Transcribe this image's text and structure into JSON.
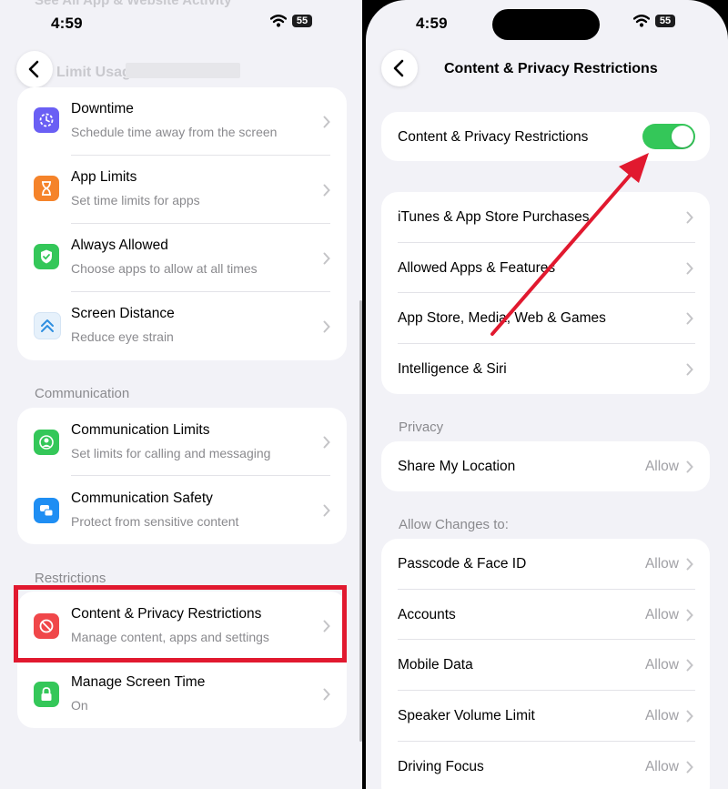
{
  "left": {
    "status": {
      "time": "4:59",
      "battery": "55"
    },
    "faded_top": "See All App & Website Activity",
    "faded_header": "Limit Usage",
    "rows_usage": [
      {
        "title": "Downtime",
        "subtitle": "Schedule time away from the screen",
        "icon": "downtime-icon",
        "color": "#6a5ff4"
      },
      {
        "title": "App Limits",
        "subtitle": "Set time limits for apps",
        "icon": "hourglass-icon",
        "color": "#f5832a"
      },
      {
        "title": "Always Allowed",
        "subtitle": "Choose apps to allow at all times",
        "icon": "checkmark-shield-icon",
        "color": "#34c759"
      },
      {
        "title": "Screen Distance",
        "subtitle": "Reduce eye strain",
        "icon": "screen-distance-icon",
        "color": "#e6f1fb"
      }
    ],
    "communication_header": "Communication",
    "rows_communication": [
      {
        "title": "Communication Limits",
        "subtitle": "Set limits for calling and messaging",
        "icon": "person-circle-icon",
        "color": "#34c759"
      },
      {
        "title": "Communication Safety",
        "subtitle": "Protect from sensitive content",
        "icon": "chat-bubbles-icon",
        "color": "#1f8ef3"
      }
    ],
    "restrictions_header": "Restrictions",
    "rows_restrictions": [
      {
        "title": "Content & Privacy Restrictions",
        "subtitle": "Manage content, apps and settings",
        "icon": "no-entry-icon",
        "color": "#f0474a"
      },
      {
        "title": "Manage Screen Time",
        "subtitle": "On",
        "icon": "lock-icon",
        "color": "#34c759"
      }
    ]
  },
  "right": {
    "status": {
      "time": "4:59",
      "battery": "55"
    },
    "title": "Content & Privacy Restrictions",
    "toggle_label": "Content & Privacy Restrictions",
    "toggle_on": true,
    "rows_main": [
      "iTunes & App Store Purchases",
      "Allowed Apps & Features",
      "App Store, Media, Web & Games",
      "Intelligence & Siri"
    ],
    "privacy_header": "Privacy",
    "privacy_rows": [
      {
        "label": "Share My Location",
        "value": "Allow"
      }
    ],
    "allow_header": "Allow Changes to:",
    "allow_rows": [
      {
        "label": "Passcode & Face ID",
        "value": "Allow"
      },
      {
        "label": "Accounts",
        "value": "Allow"
      },
      {
        "label": "Mobile Data",
        "value": "Allow"
      },
      {
        "label": "Speaker Volume Limit",
        "value": "Allow"
      },
      {
        "label": "Driving Focus",
        "value": "Allow"
      }
    ]
  },
  "colors": {
    "highlight": "#e1192f",
    "arrow": "#e1192f",
    "toggle_on": "#34c759",
    "background": "#f2f2f7"
  }
}
